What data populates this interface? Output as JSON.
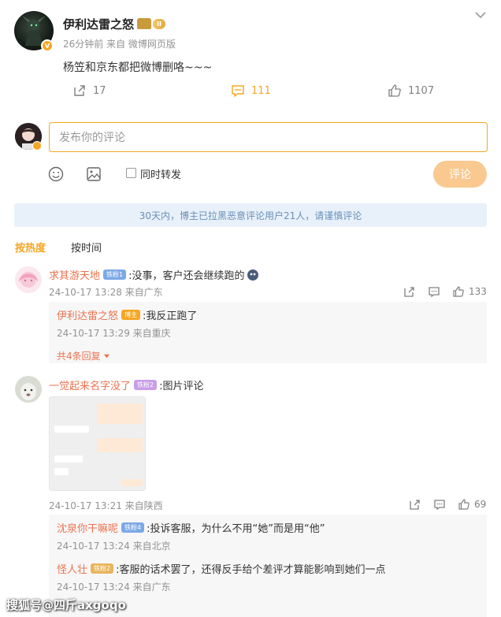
{
  "post": {
    "username": "伊利达雷之怒",
    "vip_level": "II",
    "meta": "26分钟前  来自 微博网页版",
    "text": "杨笠和京东都把微博删咯~~~",
    "repost_count": "17",
    "comment_count": "111",
    "like_count": "1107"
  },
  "composer": {
    "placeholder": "发布你的评论",
    "repost_label": "同时转发",
    "submit_label": "评论"
  },
  "notice": "30天内，博主已拉黑恶意评论用户21人，请谨慎评论",
  "sort_tabs": [
    "按热度",
    "按时间"
  ],
  "comments": [
    {
      "name": "求其游天地",
      "badge": "铁粉1",
      "text": ":没事，客户还会继续跑的",
      "meta": "24-10-17 13:28 来自广东",
      "likes": "133",
      "replies": [
        {
          "name": "伊利达雷之怒",
          "badge": "博主",
          "text": ":我反正跑了",
          "meta": "24-10-17 13:29 来自重庆"
        }
      ],
      "more_replies": "共4条回复"
    },
    {
      "name": "一觉起来名字没了",
      "badge": "铁粉2",
      "text": ":图片评论",
      "meta": "24-10-17 13:21 来自陕西",
      "likes": "69",
      "replies": [
        {
          "name": "沈泉你干嘛呢",
          "badge": "铁粉4",
          "text": ":投诉客服，为什么不用“她”而是用“他”",
          "meta": "24-10-17 13:24 来自北京"
        },
        {
          "name": "怪人壮",
          "badge": "铁粉2",
          "text": ":客服的话术罢了，还得反手给个差评才算能影响到她们一点",
          "meta": "24-10-17 13:24 来自广东"
        }
      ]
    }
  ],
  "watermark": "搜狐号@四斤axgoqo",
  "colors": {
    "accent": "#f6a623",
    "name": "#eb7350",
    "notice_bg": "#e8f1fa"
  }
}
